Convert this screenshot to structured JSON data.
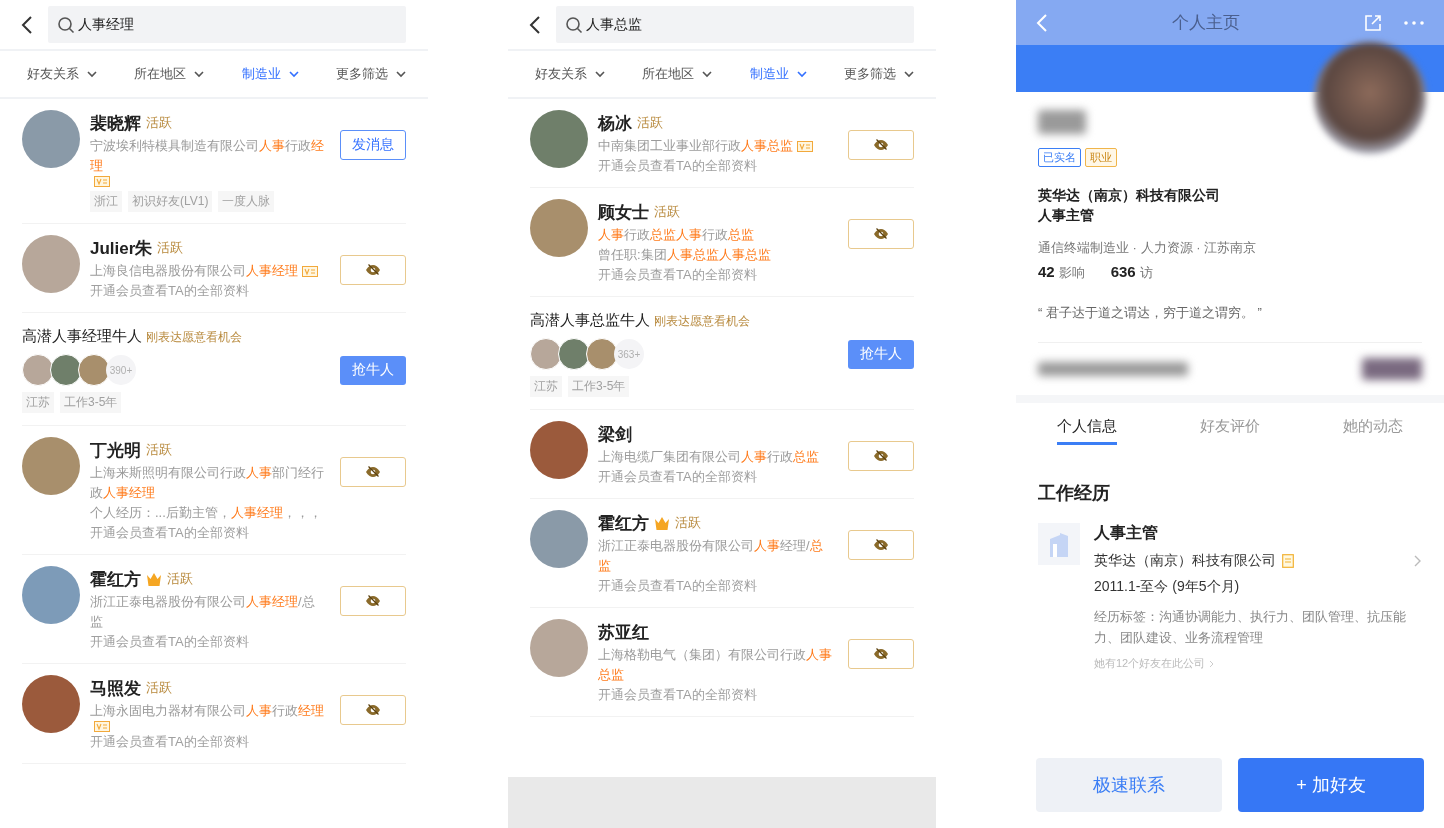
{
  "screens": [
    {
      "kind": "search",
      "search": {
        "value": "人事经理"
      },
      "filters": [
        {
          "label": "好友关系",
          "selected": false
        },
        {
          "label": "所在地区",
          "selected": false
        },
        {
          "label": "制造业",
          "selected": true
        },
        {
          "label": "更多筛选",
          "selected": false
        }
      ],
      "results": [
        {
          "kind": "person",
          "name": "裴晓辉",
          "crown": false,
          "status": "活跃",
          "lines": [
            "宁波埃利特模具制造有限公司**人事**行政**经理**"
          ],
          "verified": true,
          "tags": [
            "浙江",
            "初识好友(LV1)",
            "一度人脉"
          ],
          "action": {
            "kind": "message",
            "label": "发消息"
          }
        },
        {
          "kind": "person",
          "name": "Julier朱",
          "crown": false,
          "status": "活跃",
          "lines": [
            "上海良信电器股份有限公司**人事经理**"
          ],
          "verified": true,
          "note": "开通会员查看TA的全部资料",
          "action": {
            "kind": "hidden"
          }
        },
        {
          "kind": "promo",
          "title": "高潜人事经理牛人",
          "subtitle": "刚表达愿意看机会",
          "count": "390+",
          "tags": [
            "江苏",
            "工作3-5年"
          ],
          "button": "抢牛人"
        },
        {
          "kind": "person",
          "name": "丁光明",
          "crown": false,
          "status": "活跃",
          "lines": [
            "上海来斯照明有限公司行政**人事**部门经行政**人事经理**",
            "个人经历：...后勤主管，**人事经理**，，，"
          ],
          "verified": false,
          "note": "开通会员查看TA的全部资料",
          "action": {
            "kind": "hidden"
          }
        },
        {
          "kind": "person",
          "name": "霍红方",
          "crown": true,
          "status": "活跃",
          "lines": [
            "浙江正泰电器股份有限公司**人事经理**/总监"
          ],
          "verified": false,
          "note": "开通会员查看TA的全部资料",
          "action": {
            "kind": "hidden"
          }
        },
        {
          "kind": "person",
          "name": "马照发",
          "crown": false,
          "status": "活跃",
          "lines": [
            "上海永固电力器材有限公司**人事**行政**经理**"
          ],
          "verified": true,
          "note": "开通会员查看TA的全部资料",
          "action": {
            "kind": "hidden"
          }
        }
      ]
    },
    {
      "kind": "search",
      "search": {
        "value": "人事总监"
      },
      "footer": true,
      "filters": [
        {
          "label": "好友关系",
          "selected": false
        },
        {
          "label": "所在地区",
          "selected": false
        },
        {
          "label": "制造业",
          "selected": true
        },
        {
          "label": "更多筛选",
          "selected": false
        }
      ],
      "results": [
        {
          "kind": "person",
          "name": "杨冰",
          "crown": false,
          "status": "活跃",
          "lines": [
            "中南集团工业事业部行政**人事总监**"
          ],
          "verified": true,
          "note": "开通会员查看TA的全部资料",
          "action": {
            "kind": "hidden"
          }
        },
        {
          "kind": "person",
          "name": "顾女士",
          "crown": false,
          "status": "活跃",
          "lines": [
            "**人事**行政**总监人事**行政**总监**",
            "曾任职:集团**人事总监人事总监**"
          ],
          "verified": false,
          "note": "开通会员查看TA的全部资料",
          "action": {
            "kind": "hidden"
          }
        },
        {
          "kind": "promo",
          "title": "高潜人事总监牛人",
          "subtitle": "刚表达愿意看机会",
          "count": "363+",
          "tags": [
            "江苏",
            "工作3-5年"
          ],
          "button": "抢牛人"
        },
        {
          "kind": "person",
          "name": "梁剑",
          "crown": false,
          "lines": [
            "上海电缆厂集团有限公司**人事**行政**总监**"
          ],
          "verified": false,
          "note": "开通会员查看TA的全部资料",
          "action": {
            "kind": "hidden"
          }
        },
        {
          "kind": "person",
          "name": "霍红方",
          "crown": true,
          "status": "活跃",
          "lines": [
            "浙江正泰电器股份有限公司**人事**经理/**总监**"
          ],
          "verified": false,
          "note": "开通会员查看TA的全部资料",
          "action": {
            "kind": "hidden"
          }
        },
        {
          "kind": "person",
          "name": "苏亚红",
          "crown": false,
          "lines": [
            "上海格勒电气（集团）有限公司行政**人事总监**"
          ],
          "verified": false,
          "note": "开通会员查看TA的全部资料",
          "action": {
            "kind": "hidden"
          }
        }
      ]
    },
    {
      "kind": "profile",
      "title": "个人主页",
      "badges": [
        {
          "kind": "realname",
          "label": "已实名"
        },
        {
          "kind": "job",
          "label": "职业"
        }
      ],
      "company": "英华达（南京）科技有限公司",
      "position": "人事主管",
      "meta": "通信终端制造业 · 人力资源 · 江苏南京",
      "stats": [
        {
          "value": "42",
          "label": "影响"
        },
        {
          "value": "636",
          "label": "访"
        }
      ],
      "quote": "“ 君子达于道之谓达，穷于道之谓穷。 ”",
      "tabs": [
        {
          "label": "个人信息",
          "selected": true
        },
        {
          "label": "好友评价",
          "selected": false
        },
        {
          "label": "她的动态",
          "selected": false
        }
      ],
      "section_title": "工作经历",
      "experience": {
        "title": "人事主管",
        "company": "英华达（南京）科技有限公司",
        "period": "2011.1-至今 (9年5个月)",
        "tags": "经历标签：沟通协调能力、执行力、团队管理、抗压能力、团队建设、业务流程管理",
        "friends": "她有12个好友在此公司"
      },
      "buttons": [
        {
          "kind": "secondary",
          "label": "极速联系"
        },
        {
          "kind": "primary",
          "label": "+ 加好友"
        }
      ]
    }
  ]
}
